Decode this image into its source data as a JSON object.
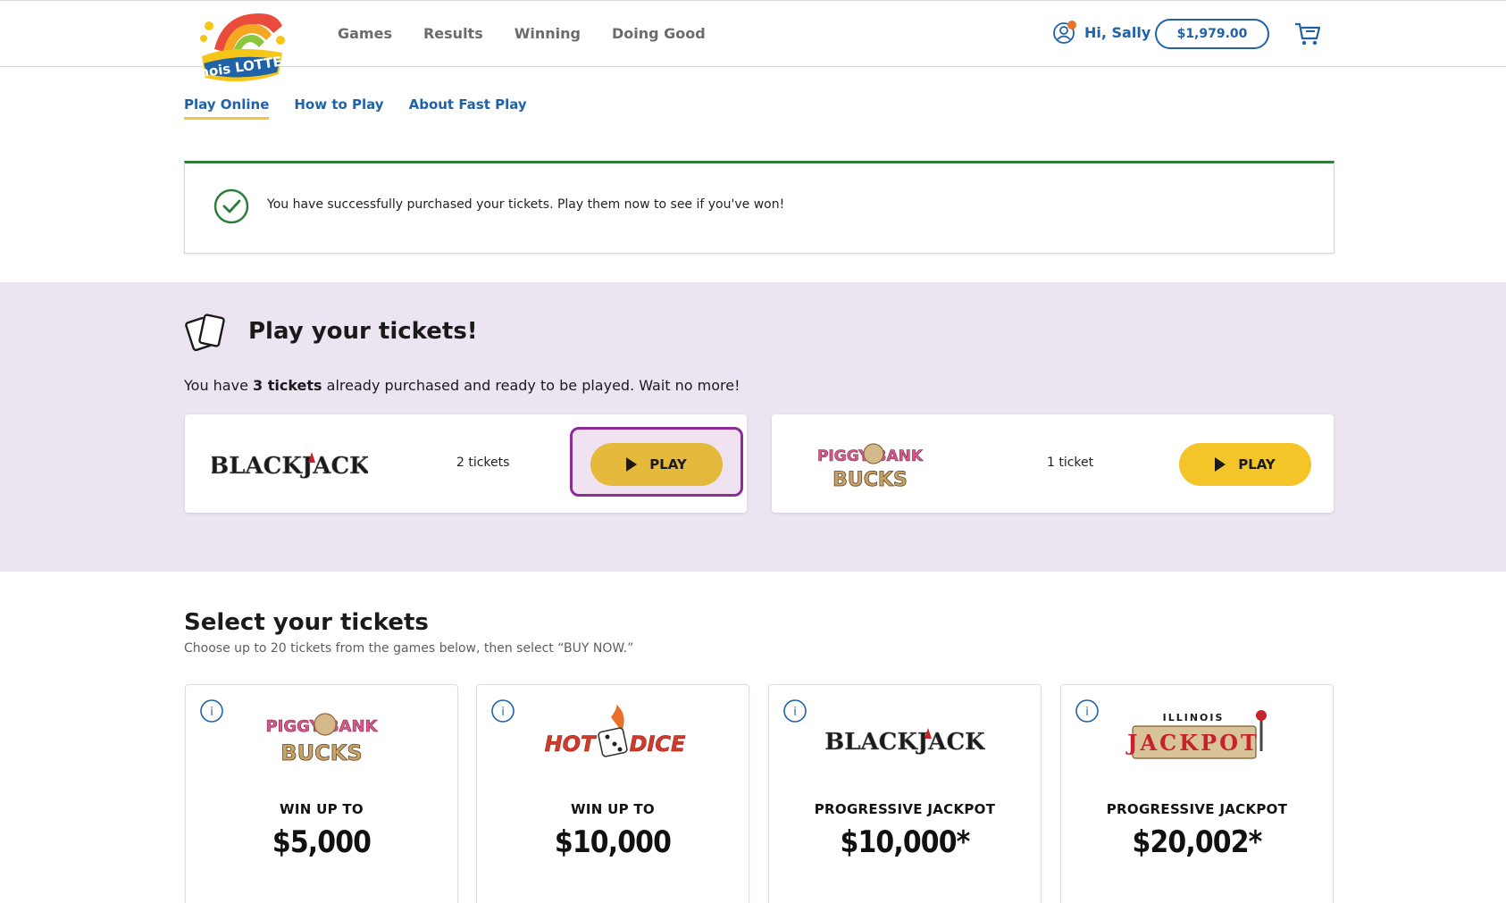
{
  "header": {
    "logo_text": "Illinois LOTTERY",
    "nav": [
      "Games",
      "Results",
      "Winning",
      "Doing Good"
    ],
    "greeting": "Hi, Sally",
    "balance": "$1,979.00"
  },
  "subnav": [
    "Play Online",
    "How to Play",
    "About Fast Play"
  ],
  "success": {
    "message": "You have successfully purchased your tickets. Play them now to see if you've won!"
  },
  "play": {
    "title": "Play your tickets!",
    "sub_prefix": "You have ",
    "sub_bold": "3 tickets",
    "sub_suffix": " already purchased and ready to be played. Wait no more!",
    "tickets": [
      {
        "game": "BLACKJACK",
        "count": "2 tickets",
        "button": "PLAY"
      },
      {
        "game": "PIGGY BANK BUCKS",
        "count": "1 ticket",
        "button": "PLAY"
      }
    ]
  },
  "select": {
    "title": "Select your tickets",
    "subtitle": "Choose up to 20 tickets from the games below, then select “BUY NOW.”",
    "games": [
      {
        "logo": "PIGGY BANK BUCKS",
        "label": "WIN UP TO",
        "amount": "$5,000"
      },
      {
        "logo": "HOT DICE",
        "label": "WIN UP TO",
        "amount": "$10,000"
      },
      {
        "logo": "BLACKJACK",
        "label": "PROGRESSIVE JACKPOT",
        "amount": "$10,000*"
      },
      {
        "logo": "ILLINOIS JACKPOT",
        "label": "PROGRESSIVE JACKPOT",
        "amount": "$20,002*"
      }
    ]
  },
  "colors": {
    "brand_blue": "#1f62a8",
    "play_yellow": "#f3c528",
    "success_green": "#2e7d3a",
    "section_lavender": "#ede4f1",
    "focus_purple": "#8c2d96"
  }
}
